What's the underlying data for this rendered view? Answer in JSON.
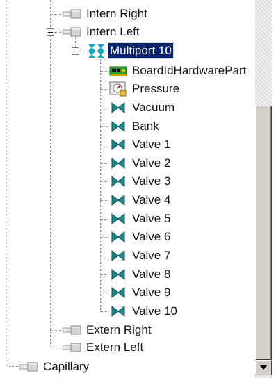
{
  "tree": {
    "items": [
      {
        "label": "Intern Right",
        "icon": "connector-icon",
        "selected": false
      },
      {
        "label": "Intern Left",
        "icon": "connector-icon",
        "selected": false,
        "expanded": true
      },
      {
        "label": "Multiport 10",
        "icon": "multiport-icon",
        "selected": true,
        "expanded": true
      },
      {
        "label": "BoardIdHardwarePart",
        "icon": "board-icon",
        "selected": false
      },
      {
        "label": "Pressure",
        "icon": "pressure-gauge-icon",
        "selected": false
      },
      {
        "label": "Vacuum",
        "icon": "valve-icon",
        "selected": false
      },
      {
        "label": "Bank",
        "icon": "valve-icon",
        "selected": false
      },
      {
        "label": "Valve 1",
        "icon": "valve-icon",
        "selected": false
      },
      {
        "label": "Valve 2",
        "icon": "valve-icon",
        "selected": false
      },
      {
        "label": "Valve 3",
        "icon": "valve-icon",
        "selected": false
      },
      {
        "label": "Valve 4",
        "icon": "valve-icon",
        "selected": false
      },
      {
        "label": "Valve 5",
        "icon": "valve-icon",
        "selected": false
      },
      {
        "label": "Valve 6",
        "icon": "valve-icon",
        "selected": false
      },
      {
        "label": "Valve 7",
        "icon": "valve-icon",
        "selected": false
      },
      {
        "label": "Valve 8",
        "icon": "valve-icon",
        "selected": false
      },
      {
        "label": "Valve 9",
        "icon": "valve-icon",
        "selected": false
      },
      {
        "label": "Valve 10",
        "icon": "valve-icon",
        "selected": false
      },
      {
        "label": "Extern Right",
        "icon": "connector-icon",
        "selected": false
      },
      {
        "label": "Extern Left",
        "icon": "connector-icon",
        "selected": false
      },
      {
        "label": "Capillary",
        "icon": "connector-icon",
        "selected": false
      }
    ]
  },
  "colors": {
    "selection": "#0a246a",
    "valve": "#1a8a8a",
    "multiport": "#18a6c8",
    "board": "#2f9a2f"
  }
}
